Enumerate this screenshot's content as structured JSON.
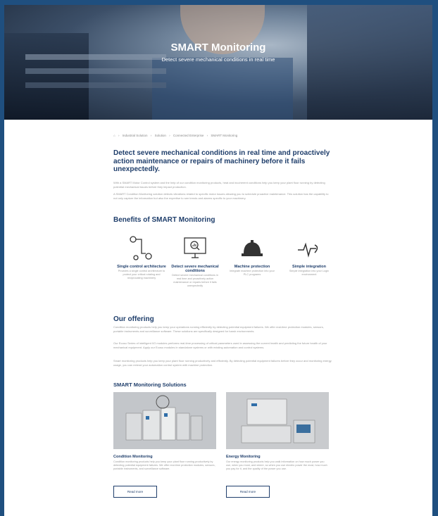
{
  "hero": {
    "title": "SMART Monitoring",
    "subtitle": "Detect severe mechanical conditions in real time"
  },
  "breadcrumb": {
    "items": [
      "Industrial Solution",
      "Solution",
      "Connected Enterprise",
      "SMART Monitoring"
    ],
    "separator": "›",
    "home_icon": "home-icon"
  },
  "intro": {
    "heading": "Detect severe mechanical conditions in real time and proactively action maintenance or repairs of machinery before it fails unexpectedly.",
    "paragraph1": "With a SMART Motor Control system and the help of our condition monitoring products, heat and incoherent conditions help you keep your plant floor running by detecting potential mechanical issues before they impact production.",
    "paragraph2": "A SMART Condition Monitoring solution detects vibrations related to specific motor issues allowing you to schedule proactive maintenance. This solution has the capability to not only capture the information but also the expertise to see trends and alarms specific to your machinery."
  },
  "benefits": {
    "heading": "Benefits of SMART Monitoring",
    "items": [
      {
        "title": "Single control architecture",
        "desc": "Provides a single control architecture to protect your critical rotating and reciprocating machinery",
        "icon": "network-nodes-icon"
      },
      {
        "title": "Detect severe mechanical conditions",
        "desc": "Detect severe mechanical conditions in real time and proactively action maintenance or repairs before it fails unexpectedly",
        "icon": "monitor-analytics-icon"
      },
      {
        "title": "Machine protection",
        "desc": "Integrate machine protection into your PLC programs",
        "icon": "hard-hat-icon"
      },
      {
        "title": "Simple integration",
        "desc": "Simple integration into your Logix environment",
        "icon": "pulse-integration-icon"
      }
    ]
  },
  "offering": {
    "heading": "Our offering",
    "paragraph1": "Condition monitoring products help you keep your operations running efficiently by detecting potential equipment failures. We offer real-time protection modules, sensors, portable instruments and surveillance software. These solutions are specifically designed for harsh environments.",
    "paragraph2": "Our Ecoso Series of intelligent I/O modules performs real-time processing of critical parameters used in assessing the current health and predicting the future health of your mechanical equipment. Apply our Ecoso modules in standalone systems or with existing automation and control systems.",
    "paragraph3": "Smart monitoring products help you keep your plant floor running productively and efficiently. By detecting potential equipment failures before they occur and monitoring energy usage, you can extend your automation control system with machine protection."
  },
  "solutions": {
    "heading": "SMART Monitoring Solutions",
    "cards": [
      {
        "title": "Condition Monitoring",
        "desc": "Condition monitoring products help you keep your plant floor running productively by detecting potential equipment failures. We offer real-time protection modules, sensors, portable instruments, and surveillance software.",
        "button": "Read more"
      },
      {
        "title": "Energy Monitoring",
        "desc": "Our energy monitoring products help you walk information on how much power you use, when you most, and where, so when you use electric power the most, how much you pay for it, and the quality of the power you use.",
        "button": "Read more"
      }
    ]
  },
  "colors": {
    "brand": "#1f3e6b",
    "page_border": "#1f4f7f",
    "body_text": "#9a9a9a"
  }
}
